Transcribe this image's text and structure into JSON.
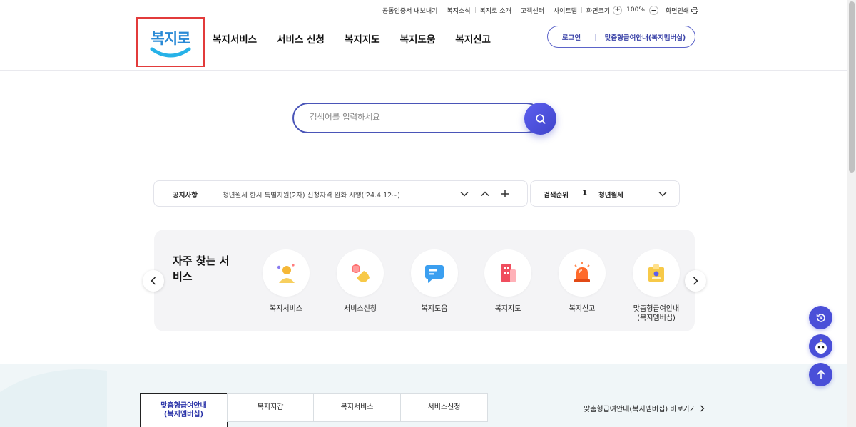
{
  "util_bar": {
    "links": [
      "공동인증서 내보내기",
      "복지소식",
      "복지로 소개",
      "고객센터",
      "사이트맵"
    ],
    "zoom_label": "화면크기",
    "zoom_plus": "+",
    "zoom_value": "100%",
    "print_label": "화면인쇄"
  },
  "header": {
    "logo_text": "복지로",
    "nav": [
      "복지서비스",
      "서비스 신청",
      "복지지도",
      "복지도움",
      "복지신고"
    ],
    "login_label": "로그인",
    "member_label": "맞춤형급여안내(복지멤버십)"
  },
  "search": {
    "placeholder": "검색어를 입력하세요"
  },
  "notice": {
    "label": "공지사항",
    "text": "청년월세 한시 특별지원(2차) 신청자격 완화 시행('24.4.12~)"
  },
  "ranking": {
    "label": "검색순위",
    "rank": "1",
    "term": "청년월세"
  },
  "services": {
    "title": "자주 찾는 서비스",
    "items": [
      {
        "label": "복지서비스",
        "icon": "person-sparkle-icon"
      },
      {
        "label": "서비스신청",
        "icon": "hand-document-icon"
      },
      {
        "label": "복지도움",
        "icon": "chat-bubble-icon"
      },
      {
        "label": "복지지도",
        "icon": "building-icon"
      },
      {
        "label": "복지신고",
        "icon": "siren-icon"
      },
      {
        "label": "맞춤형급여안내\n(복지멤버십)",
        "icon": "id-card-icon"
      }
    ]
  },
  "bottom": {
    "tabs": [
      "맞춤형급여안내\n(복지멤버십)",
      "복지지갑",
      "복지서비스",
      "서비스신청"
    ],
    "shortcut": "맞춤형급여안내(복지멤버십) 바로가기"
  },
  "colors": {
    "primary": "#4a4fd8",
    "logo_red_frame": "#e23b3b",
    "active_tab": "#2a33a8"
  }
}
